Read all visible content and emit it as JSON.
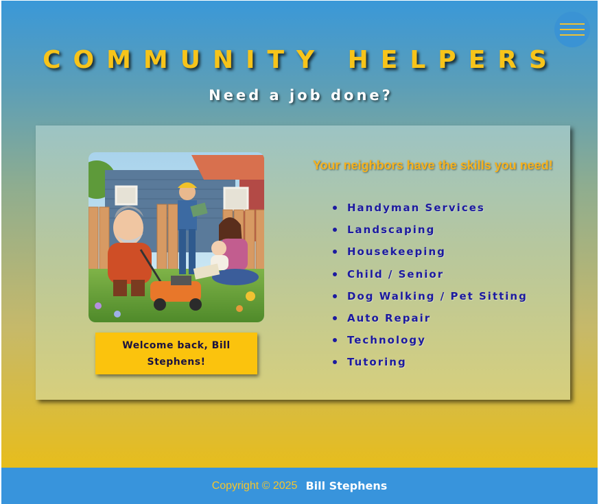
{
  "header": {
    "title": "COMMUNITY HELPERS",
    "subtitle": "Need a job done?",
    "menu_icon": "hamburger-menu-icon"
  },
  "main": {
    "image_alt": "Neighbors mowing a lawn, doing repairs and reading to a baby",
    "welcome": "Welcome back, Bill Stephens!",
    "tagline": "Your neighbors have the skills you need!",
    "skills": [
      "Handyman Services",
      "Landscaping",
      "Housekeeping",
      "Child / Senior",
      "Dog Walking / Pet Sitting",
      "Auto Repair",
      "Technology",
      "Tutoring"
    ]
  },
  "footer": {
    "copyright": "Copyright © 2025",
    "author": "Bill Stephens"
  },
  "colors": {
    "accent": "#f7c41a",
    "footer_bg": "#3894dc",
    "list_text": "#1c1aa0"
  }
}
